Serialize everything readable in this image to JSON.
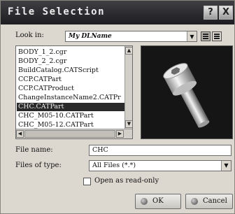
{
  "window": {
    "title": "File Selection",
    "help_glyph": "?",
    "close_glyph": "X"
  },
  "look_in": {
    "label": "Look in:",
    "value": "My DLName",
    "dropdown_arrow": "▼"
  },
  "file_list": {
    "items": [
      {
        "name": "BODY_1_2.cgr",
        "selected": false
      },
      {
        "name": "BODY_2_2.cgr",
        "selected": false
      },
      {
        "name": "BuildCatalog.CATScript",
        "selected": false
      },
      {
        "name": "CCP.CATPart",
        "selected": false
      },
      {
        "name": "CCP.CATProduct",
        "selected": false
      },
      {
        "name": "ChangeInstanceName2.CATPr",
        "selected": false
      },
      {
        "name": "CHC.CATPart",
        "selected": true
      },
      {
        "name": "CHC_M05-10.CATPart",
        "selected": false
      },
      {
        "name": "CHC_M05-12.CATPart",
        "selected": false
      }
    ],
    "scroll_up_glyph": "▲",
    "scroll_down_glyph": "▼",
    "scroll_left_glyph": "◀",
    "scroll_right_glyph": "▶"
  },
  "preview": {
    "icon": "socket-head-cap-screw-3d-preview"
  },
  "file_name": {
    "label": "File name:",
    "value": "CHC"
  },
  "files_of_type": {
    "label": "Files of type:",
    "value": "All Files (*.*)",
    "dropdown_arrow": "▼"
  },
  "read_only": {
    "label": "Open as read-only",
    "checked": false
  },
  "buttons": {
    "ok_label": "OK",
    "cancel_label": "Cancel"
  },
  "colors": {
    "selection_bg": "#2a2a2a",
    "titlebar_bg": "#2a2a2e",
    "window_bg": "#dcd8d0"
  }
}
